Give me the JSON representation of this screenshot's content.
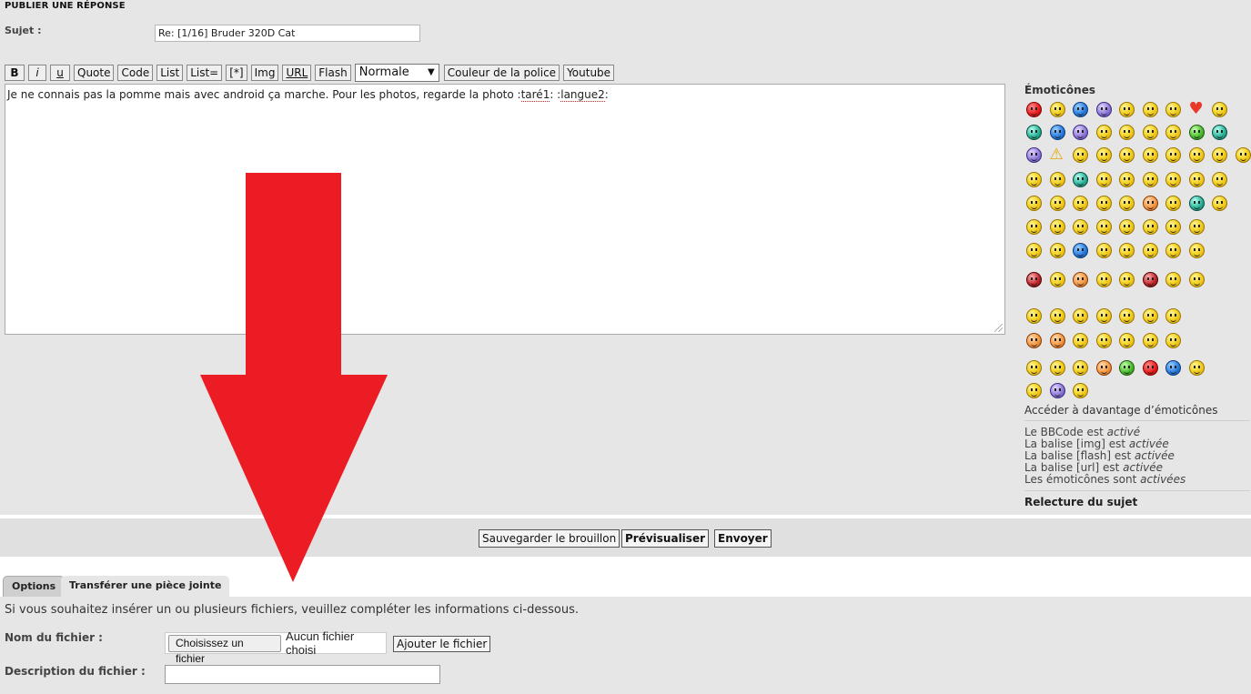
{
  "form": {
    "heading": "PUBLIER UNE RÉPONSE",
    "subject_label": "Sujet :",
    "subject_value": "Re: [1/16] Bruder 320D Cat"
  },
  "toolbar": {
    "bold": "B",
    "italic": "i",
    "underline": "u",
    "quote": "Quote",
    "code": "Code",
    "list": "List",
    "list_ordered": "List=",
    "list_item": "[*]",
    "img": "Img",
    "url": "URL",
    "flash": "Flash",
    "font_size": "Normale",
    "font_color": "Couleur de la police",
    "youtube": "Youtube"
  },
  "message": {
    "text_before": "Je ne connais pas la pomme mais avec android ça marche. Pour les photos, regarde la photo  :",
    "smiley_code_1": "taré1",
    "text_middle": ":  :",
    "smiley_code_2": "langue2",
    "text_after": ":"
  },
  "smilies": {
    "title": "Émoticônes",
    "more_link": "Accéder à davantage d’émoticônes",
    "colors": [
      "red",
      "yellow",
      "blue",
      "purple",
      "yellow",
      "yellow",
      "hat",
      "heart",
      "yellow",
      "teal",
      "blue",
      "purple",
      "yellow",
      "yellow",
      "yellow",
      "yellow",
      "green",
      "teal",
      "purple",
      "warn",
      "yellow",
      "yellow",
      "yellow",
      "yellow",
      "yellow",
      "yellow",
      "yellow",
      "yellow",
      "yellow",
      "yellow",
      "teal",
      "yellow",
      "yellow",
      "yellow",
      "yellow",
      "yellow",
      "yellow",
      "yellow",
      "yellow",
      "yellow",
      "yellow",
      "yellow",
      "orange",
      "yellow",
      "teal",
      "yellow",
      "yellow",
      "yellow",
      "yellow",
      "yellow",
      "yellow",
      "yellow",
      "yellow",
      "yellow",
      "yellow",
      "yellow",
      "blue",
      "yellow",
      "yellow",
      "yellow",
      "yellow",
      "yellow",
      "dark",
      "yellow",
      "orange",
      "yellow",
      "yellow",
      "dark",
      "yellow",
      "yellow",
      "yellow",
      "yellow",
      "yellow",
      "yellow",
      "yellow",
      "yellow",
      "yellow",
      "orange",
      "orange",
      "yellow",
      "yellow",
      "yellow",
      "yellow",
      "yellow",
      "yellow",
      "yellow",
      "yellow",
      "orange",
      "green",
      "red",
      "blue",
      "yellow",
      "yellow",
      "purple",
      "yellow"
    ]
  },
  "status": {
    "bbcode_prefix": "Le BBCode est ",
    "bbcode_state": "activé",
    "img_prefix": "La balise [img] est ",
    "img_state": "activée",
    "flash_prefix": "La balise [flash] est ",
    "flash_state": "activée",
    "url_prefix": "La balise [url] est ",
    "url_state": "activée",
    "smilies_prefix": "Les émoticônes sont ",
    "smilies_state": "activées"
  },
  "topic_review": "Relecture du sujet",
  "buttons": {
    "save_draft": "Sauvegarder le brouillon",
    "preview": "Prévisualiser",
    "submit": "Envoyer"
  },
  "tabs": [
    {
      "label": "Options"
    },
    {
      "label": "Transférer une pièce jointe"
    }
  ],
  "attachment": {
    "help": "Si vous souhaitez insérer un ou plusieurs fichiers, veuillez compléter les informations ci-dessous.",
    "filename_label": "Nom du fichier :",
    "choose_file": "Choisissez un fichier",
    "no_file": "Aucun fichier choisi",
    "add_file": "Ajouter le fichier",
    "description_label": "Description du fichier :",
    "description_value": ""
  },
  "overlay": {
    "arrow_color": "#ec1c24"
  }
}
